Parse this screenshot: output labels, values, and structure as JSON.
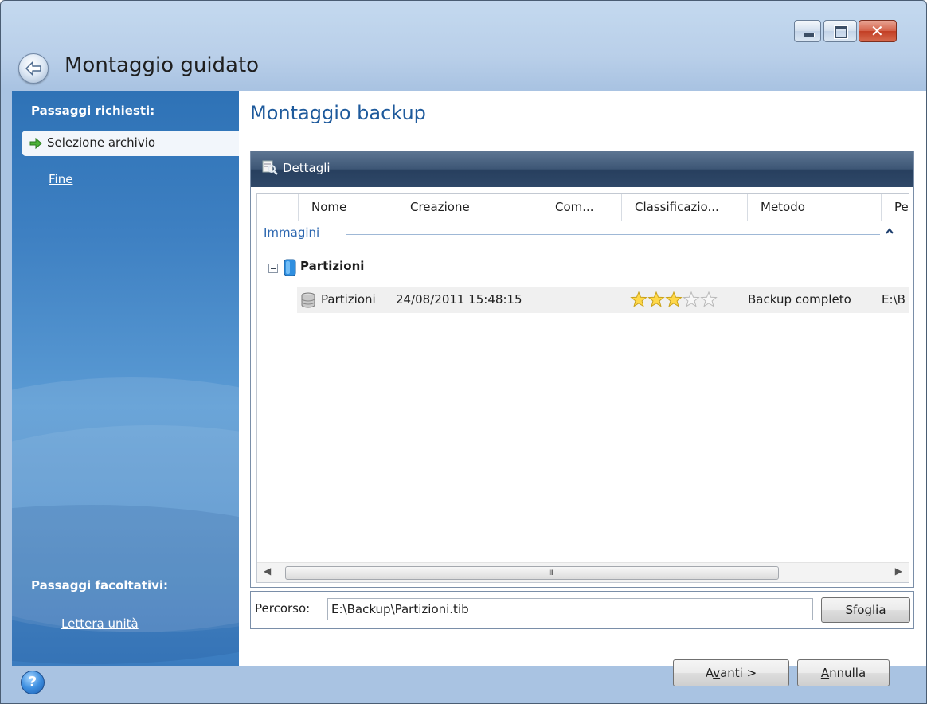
{
  "window": {
    "title": "Montaggio guidato",
    "controls": {
      "minimize": "minimize-icon",
      "maximize": "maximize-icon",
      "close": "close-icon"
    }
  },
  "sidebar": {
    "required_heading": "Passaggi richiesti:",
    "steps": [
      {
        "label": "Selezione archivio",
        "selected": true,
        "icon": "green-arrow-icon"
      },
      {
        "label": "Fine",
        "selected": false
      }
    ],
    "optional_heading": "Passaggi facoltativi:",
    "optional_steps": [
      {
        "label": "Lettera unità"
      }
    ]
  },
  "main": {
    "title": "Montaggio backup",
    "details_panel": {
      "title": "Dettagli",
      "icon": "details-magnifier-icon",
      "columns": [
        "Nome",
        "Creazione",
        "Com...",
        "Classificazio...",
        "Metodo",
        "Pe"
      ],
      "group": {
        "label": "Immagini",
        "collapsed": false
      },
      "tree_node": {
        "label": "Partizioni",
        "expanded": true
      },
      "rows": [
        {
          "name": "Partizioni",
          "created": "24/08/2011 15:48:15",
          "comment": "",
          "rating_stars": 3,
          "rating_max": 5,
          "method": "Backup completo",
          "path": "E:\\B"
        }
      ],
      "scrollbar_grip": "III"
    },
    "path_field": {
      "label": "Percorso:",
      "value": "E:\\Backup\\Partizioni.tib"
    },
    "browse_button": "Sfoglia"
  },
  "footer": {
    "help": "?",
    "next_button": {
      "prefix": "A",
      "accel": "v",
      "rest": "anti >"
    },
    "cancel_button": {
      "prefix": "",
      "accel": "A",
      "rest": "nnulla"
    }
  },
  "colors": {
    "sidebar": "#3e80c2",
    "accent_title": "#1e5a9c",
    "panel_header": "#2f4868",
    "link_group": "#2d67b0"
  }
}
